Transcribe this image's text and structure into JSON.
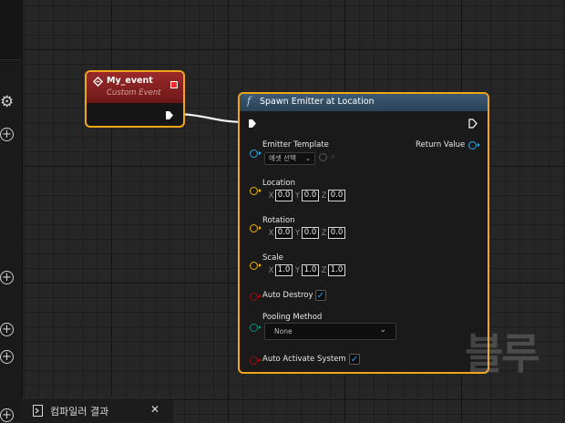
{
  "event_node": {
    "title": "My_event",
    "subtitle": "Custom Event"
  },
  "spawn_node": {
    "title": "Spawn Emitter at Location",
    "emitter_template": {
      "label": "Emitter Template",
      "select_placeholder": "에셋 선택"
    },
    "return_value": "Return Value",
    "location": {
      "label": "Location",
      "x": "0.0",
      "y": "0.0",
      "z": "0.0"
    },
    "rotation": {
      "label": "Rotation",
      "x": "0.0",
      "y": "0.0",
      "z": "0.0"
    },
    "scale": {
      "label": "Scale",
      "x": "1.0",
      "y": "1.0",
      "z": "1.0"
    },
    "auto_destroy": {
      "label": "Auto Destroy",
      "checked": true
    },
    "pooling_method": {
      "label": "Pooling Method",
      "value": "None"
    },
    "auto_activate": {
      "label": "Auto Activate System",
      "checked": true
    },
    "axis": {
      "x": "X",
      "y": "Y",
      "z": "Z"
    }
  },
  "bottom_tab": {
    "label": "컴파일러 결과",
    "close": "✕"
  },
  "watermark": "블루",
  "colors": {
    "selection": "#f3a51a",
    "event_header": "#9b2a2a",
    "function_header": "#3d5a72",
    "object_pin": "#29a7e1",
    "vector_pin": "#f0b400",
    "bool_pin": "#9c1010",
    "enum_pin": "#0e8f84",
    "check": "#2aa0ff"
  }
}
